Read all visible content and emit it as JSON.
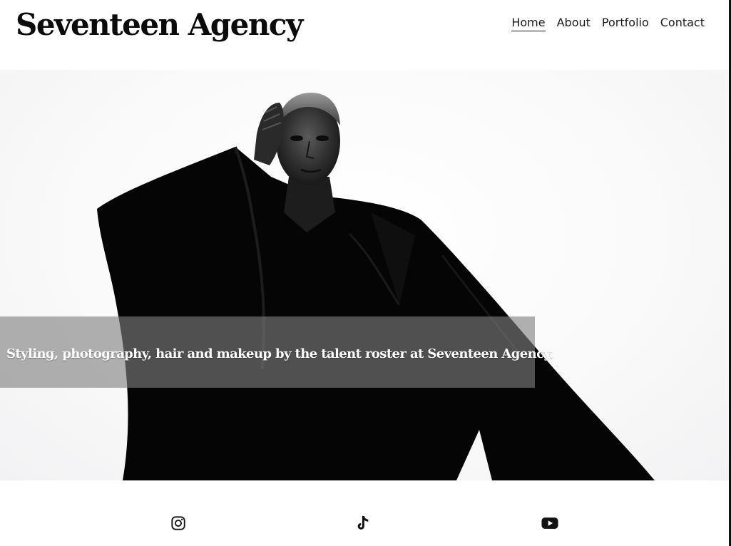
{
  "site": {
    "title": "Seventeen Agency"
  },
  "nav": {
    "items": [
      {
        "label": "Home",
        "active": true
      },
      {
        "label": "About",
        "active": false
      },
      {
        "label": "Portfolio",
        "active": false
      },
      {
        "label": "Contact",
        "active": false
      }
    ]
  },
  "hero": {
    "caption": "Styling, photography, hair and makeup by the talent roster at Seventeen Agency.",
    "overlay_color": "#808080"
  },
  "social": {
    "icons": [
      "instagram-icon",
      "tiktok-icon",
      "youtube-icon"
    ]
  },
  "colors": {
    "text": "#111111",
    "background": "#ffffff"
  }
}
